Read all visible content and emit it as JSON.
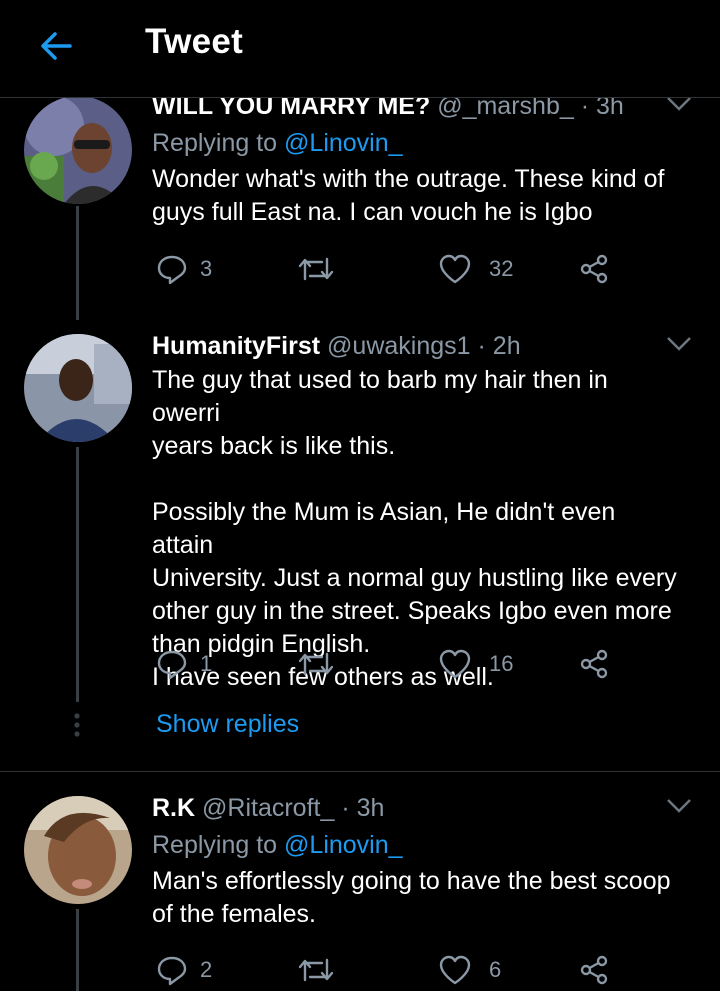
{
  "header": {
    "title": "Tweet",
    "back_icon": "arrow-left-icon",
    "accent": "#1d9bf0"
  },
  "tweets": [
    {
      "name": "WILL YOU MARRY ME?",
      "handle": "@_marshb_",
      "time": "· 3h",
      "replying_label": "Replying to",
      "replying_to": "@Linovin_",
      "text": "Wonder what's with the outrage. These kind of\nguys full East na. I can vouch he is Igbo",
      "replies": "3",
      "retweets": "",
      "likes": "32"
    },
    {
      "name": "HumanityFirst",
      "handle": "@uwakings1",
      "time": "· 2h",
      "text": "The guy that used to barb my hair then in owerri\nyears back is like this.\n\nPossibly the Mum is Asian, He didn't even attain\nUniversity. Just a normal guy hustling like every\nother guy in the street.  Speaks Igbo even more\nthan pidgin English.\nI have seen few others as well.",
      "replies": "1",
      "retweets": "",
      "likes": "16"
    },
    {
      "name": "R.K",
      "handle": "@Ritacroft_",
      "time": "· 3h",
      "replying_label": "Replying to",
      "replying_to": "@Linovin_",
      "text": "Man's effortlessly going to have the best scoop\nof the females.",
      "replies": "2",
      "retweets": "",
      "likes": "6"
    }
  ],
  "show_replies": "Show replies"
}
